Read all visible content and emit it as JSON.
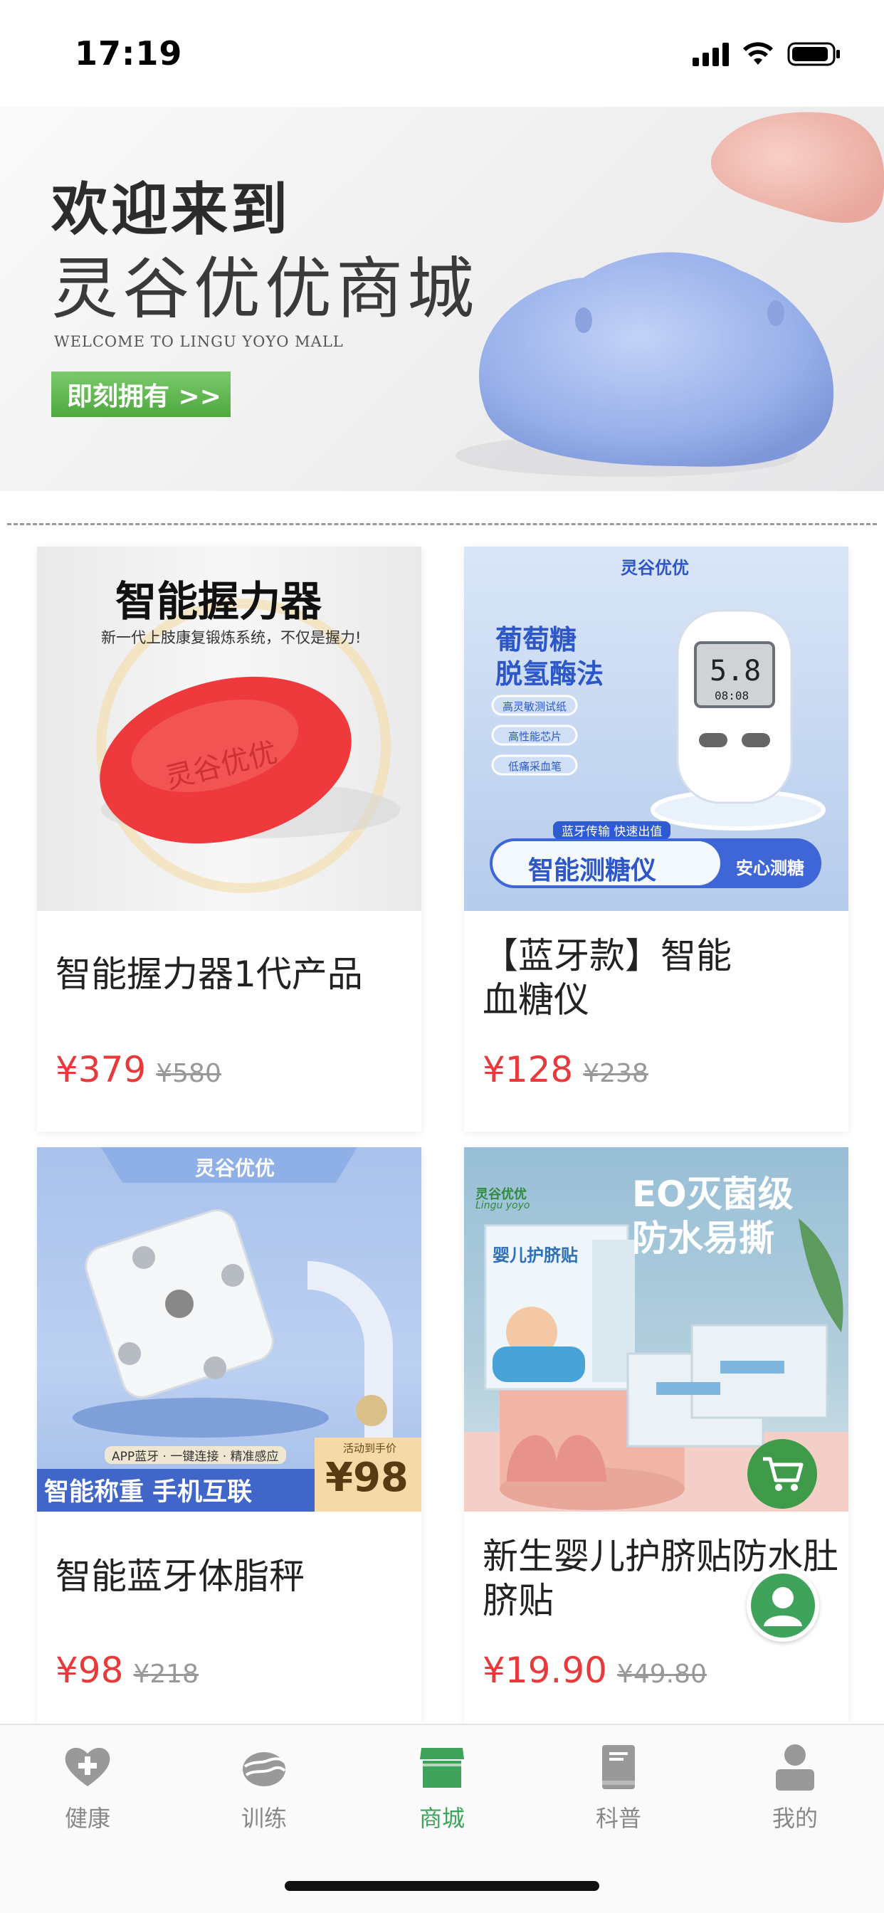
{
  "status_bar": {
    "time": "17:19"
  },
  "banner": {
    "title_line1": "欢迎来到",
    "title_line2": "灵谷优优商城",
    "subtitle": "WELCOME TO LINGU YOYO MALL",
    "cta_label": "即刻拥有 >>"
  },
  "products": [
    {
      "name": "智能握力器1代产品",
      "price": "¥379",
      "original_price": "¥580",
      "image_text": {
        "title": "智能握力器",
        "caption": "新一代上肢康复锻炼系统，不仅是握力!",
        "logo": "灵谷优优"
      }
    },
    {
      "name": "【蓝牙款】智能血糖仪",
      "price": "¥128",
      "original_price": "¥238",
      "image_text": {
        "brand": "灵谷优优",
        "headline1": "葡萄糖",
        "headline2": "脱氢酶法",
        "features": [
          "高灵敏测试纸",
          "高性能芯片",
          "低痛采血笔"
        ],
        "screen_value": "5.8",
        "screen_time": "08:08",
        "bluetooth": "蓝牙传输 快速出值",
        "badge_main": "智能测糖仪",
        "badge_side": "安心测糖"
      }
    },
    {
      "name": "智能蓝牙体脂秤",
      "price": "¥98",
      "original_price": "¥218",
      "image_text": {
        "brand": "灵谷优优",
        "tagline": "APP蓝牙 · 一键连接 · 精准感应",
        "bottom_slogan": "智能称重 手机互联",
        "promo_label": "活动到手价",
        "promo_price": "¥98"
      }
    },
    {
      "name": "新生婴儿护脐贴防水肚脐贴",
      "price": "¥19.90",
      "original_price": "¥49.80",
      "image_text": {
        "brand": "灵谷优优",
        "brand_en": "Lingu yoyo",
        "headline1": "EO灭菌级",
        "headline2": "防水易撕",
        "box_label": "婴儿护脐贴"
      }
    }
  ],
  "tabbar": {
    "items": [
      {
        "label": "健康",
        "icon": "heart-plus-icon"
      },
      {
        "label": "训练",
        "icon": "grip-ball-icon"
      },
      {
        "label": "商城",
        "icon": "store-icon",
        "active": true
      },
      {
        "label": "科普",
        "icon": "book-icon"
      },
      {
        "label": "我的",
        "icon": "person-icon"
      }
    ]
  },
  "colors": {
    "accent": "#3fa35b",
    "price": "#e83a3a",
    "cta": "#5cb34b"
  }
}
